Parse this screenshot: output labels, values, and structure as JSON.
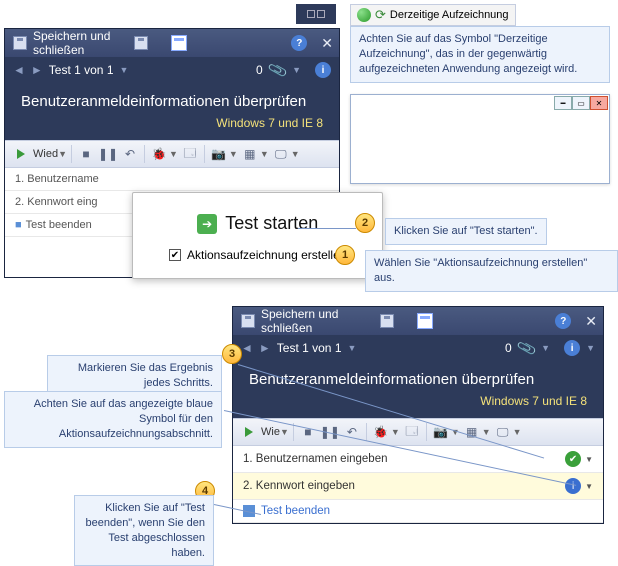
{
  "recBar": true,
  "recIndicator": {
    "label": "Derzeitige Aufzeichnung"
  },
  "callouts": {
    "c1": "Achten Sie auf das Symbol \"Derzeitige Aufzeichnung\", das in der gegenwärtig aufgezeichneten Anwendung angezeigt wird.",
    "c2": "Klicken Sie auf \"Test starten\".",
    "c3": "Wählen Sie \"Aktionsaufzeichnung erstellen\" aus.",
    "c4": "Markieren Sie das Ergebnis jedes Schritts.",
    "c5": "Achten Sie auf das angezeigte blaue Symbol für den Aktionsaufzeichnungsabschnitt.",
    "c6": "Klicken Sie auf \"Test beenden\", wenn Sie den Test abgeschlossen haben."
  },
  "badges": {
    "b1": "1",
    "b2": "2",
    "b3": "3",
    "b4": "4"
  },
  "panel1": {
    "headerTitle": "Speichern und schließen",
    "navLabel": "Test 1 von 1",
    "counter": "0",
    "title": "Benutzeranmeldeinformationen überprüfen",
    "subtitle": "Windows 7 und IE 8",
    "toolbar": {
      "wied": "Wied"
    },
    "steps": [
      "1. Benutzername",
      "2. Kennwort eing",
      "Test beenden"
    ]
  },
  "popup": {
    "startLabel": "Test starten",
    "checkboxLabel": "Aktionsaufzeichnung erstellen",
    "checked": true
  },
  "panel2": {
    "headerTitle": "Speichern und schließen",
    "navLabel": "Test 1 von 1",
    "counter": "0",
    "title": "Benutzeranmeldeinformationen überprüfen",
    "subtitle": "Windows 7 und IE 8",
    "toolbar": {
      "wie": "Wie"
    },
    "steps": [
      {
        "label": "1. Benutzernamen eingeben",
        "mark": "pass"
      },
      {
        "label": "2. Kennwort eingeben",
        "mark": "info",
        "selected": true
      },
      {
        "label": "Test beenden",
        "blue": true
      }
    ]
  }
}
